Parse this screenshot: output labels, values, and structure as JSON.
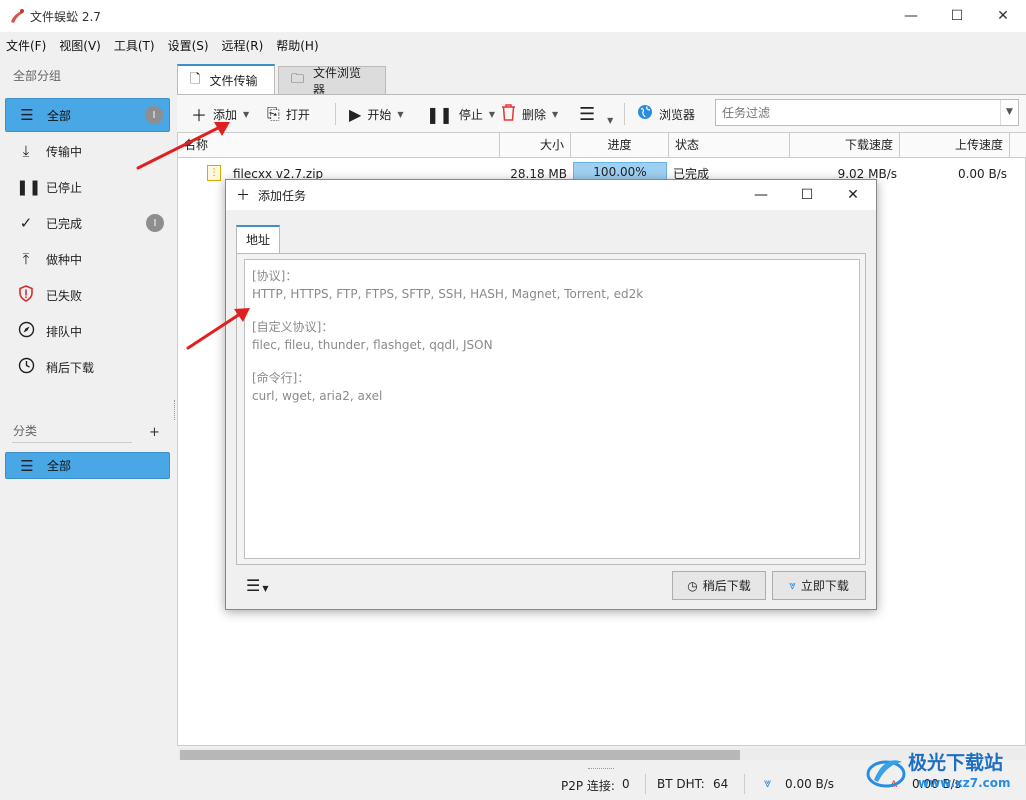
{
  "window": {
    "title": "文件蜈蚣 2.7",
    "minimize": "—",
    "maximize": "☐",
    "close": "✕"
  },
  "menubar": [
    "文件(F)",
    "视图(V)",
    "工具(T)",
    "设置(S)",
    "远程(R)",
    "帮助(H)"
  ],
  "sidebar": {
    "group_header": "全部分组",
    "items": [
      {
        "label": "全部",
        "icon": "list-icon",
        "badge": "I",
        "active": true
      },
      {
        "label": "传输中",
        "icon": "download-icon"
      },
      {
        "label": "已停止",
        "icon": "pause-icon"
      },
      {
        "label": "已完成",
        "icon": "check-icon",
        "badge": "I"
      },
      {
        "label": "做种中",
        "icon": "upload-icon"
      },
      {
        "label": "已失败",
        "icon": "shield-alert-icon"
      },
      {
        "label": "排队中",
        "icon": "compass-icon"
      },
      {
        "label": "稍后下载",
        "icon": "clock-icon"
      }
    ],
    "category_header": "分类",
    "category_add": "+",
    "categories": [
      {
        "label": "全部",
        "icon": "list-icon",
        "active": true
      }
    ]
  },
  "tabs": [
    {
      "label": "文件传输",
      "icon": "file-icon",
      "active": true
    },
    {
      "label": "文件浏览器",
      "icon": "folder-icon"
    }
  ],
  "toolbar": {
    "add": "添加",
    "open": "打开",
    "start": "开始",
    "stop": "停止",
    "delete": "删除",
    "browser": "浏览器",
    "filter_placeholder": "任务过滤"
  },
  "table": {
    "columns": [
      "名称",
      "大小",
      "进度",
      "状态",
      "下载速度",
      "上传速度"
    ],
    "rows": [
      {
        "name": "filecxx v2.7.zip",
        "size": "28.18 MB",
        "progress": "100.00%",
        "status": "已完成",
        "down": "9.02 MB/s",
        "up": "0.00 B/s"
      }
    ]
  },
  "dialog": {
    "title": "添加任务",
    "tab": "地址",
    "hints": [
      {
        "head": "[协议]：",
        "value": "HTTP, HTTPS, FTP, FTPS, SFTP, SSH, HASH, Magnet, Torrent, ed2k"
      },
      {
        "head": "[自定义协议]：",
        "value": "filec, fileu, thunder, flashget, qqdl, JSON"
      },
      {
        "head": "[命令行]：",
        "value": "curl, wget, aria2, axel"
      }
    ],
    "later_button": "稍后下载",
    "now_button": "立即下载"
  },
  "statusbar": {
    "p2p_label": "P2P 连接:",
    "p2p_value": "0",
    "dht_label": "BT DHT:",
    "dht_value": "64",
    "down_speed": "0.00 B/s",
    "up_speed": "0.00 B/s"
  },
  "watermark": {
    "text": "极光下载站",
    "url": "www.xz7.com"
  },
  "colors": {
    "accent": "#4aa7e6",
    "arrow": "#e02020",
    "progress": "#9fd0f2"
  }
}
